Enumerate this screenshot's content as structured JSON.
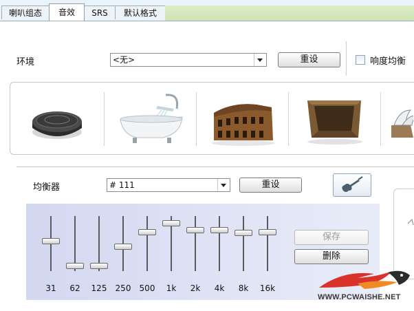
{
  "tabs": [
    {
      "label": "喇叭组态"
    },
    {
      "label": "音效"
    },
    {
      "label": "SRS"
    },
    {
      "label": "默认格式"
    }
  ],
  "environment": {
    "label": "环境",
    "selected": "<无>",
    "reset_label": "重设",
    "loudness_label": "响度均衡",
    "tiles": [
      {
        "icon": "stage-disc-icon"
      },
      {
        "icon": "bathtub-icon"
      },
      {
        "icon": "colosseum-icon"
      },
      {
        "icon": "stone-room-icon"
      },
      {
        "icon": "opera-house-icon"
      }
    ]
  },
  "equalizer": {
    "label": "均衡器",
    "selected": "# 111",
    "reset_label": "重设",
    "save_label": "保存",
    "delete_label": "删除",
    "bands": [
      {
        "freq": "31",
        "level": 0.55
      },
      {
        "freq": "62",
        "level": 0.05
      },
      {
        "freq": "125",
        "level": 0.05
      },
      {
        "freq": "250",
        "level": 0.45
      },
      {
        "freq": "500",
        "level": 0.74
      },
      {
        "freq": "1k",
        "level": 0.92
      },
      {
        "freq": "2k",
        "level": 0.78
      },
      {
        "freq": "4k",
        "level": 0.78
      },
      {
        "freq": "8k",
        "level": 0.72
      },
      {
        "freq": "16k",
        "level": 0.74
      }
    ]
  },
  "watermark": {
    "text": "WWW.PCWAISHE.NET"
  },
  "colors": {
    "tab_bg": "#e9f3f9",
    "eq_panel": "#d3d8f1",
    "tab_strip": "#cfe4b3"
  }
}
